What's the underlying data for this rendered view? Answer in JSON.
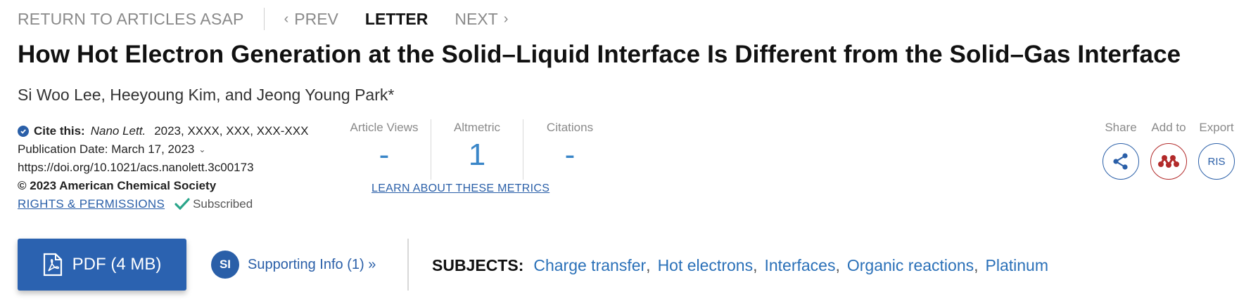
{
  "nav": {
    "back": "RETURN TO ARTICLES ASAP",
    "prev": "PREV",
    "current": "LETTER",
    "next": "NEXT"
  },
  "article": {
    "title": "How Hot Electron Generation at the Solid–Liquid Interface Is Different from the Solid–Gas Interface",
    "authors": "Si Woo Lee, Heeyoung Kim, and Jeong Young Park*"
  },
  "cite": {
    "label": "Cite this:",
    "journal": "Nano Lett.",
    "ref": "2023, XXXX, XXX, XXX-XXX",
    "pub_date": "Publication Date: March 17, 2023",
    "doi": "https://doi.org/10.1021/acs.nanolett.3c00173",
    "copyright": "© 2023 American Chemical Society",
    "rights": "RIGHTS & PERMISSIONS",
    "subscribed": "Subscribed"
  },
  "metrics": {
    "items": [
      {
        "label": "Article Views",
        "value": "-"
      },
      {
        "label": "Altmetric",
        "value": "1"
      },
      {
        "label": "Citations",
        "value": "-"
      }
    ],
    "learn": "LEARN ABOUT THESE METRICS"
  },
  "tools": {
    "share": "Share",
    "add_to": "Add to",
    "export": "Export",
    "ris": "RIS"
  },
  "actions": {
    "pdf": "PDF (4 MB)",
    "si_badge": "SI",
    "supporting": "Supporting Info (1) »"
  },
  "subjects": {
    "label": "SUBJECTS:",
    "items": [
      "Charge transfer",
      "Hot electrons",
      "Interfaces",
      "Organic reactions",
      "Platinum"
    ]
  },
  "colors": {
    "accent": "#2a5fa8",
    "metric": "#3a86c8",
    "mendeley": "#b22a2a"
  }
}
